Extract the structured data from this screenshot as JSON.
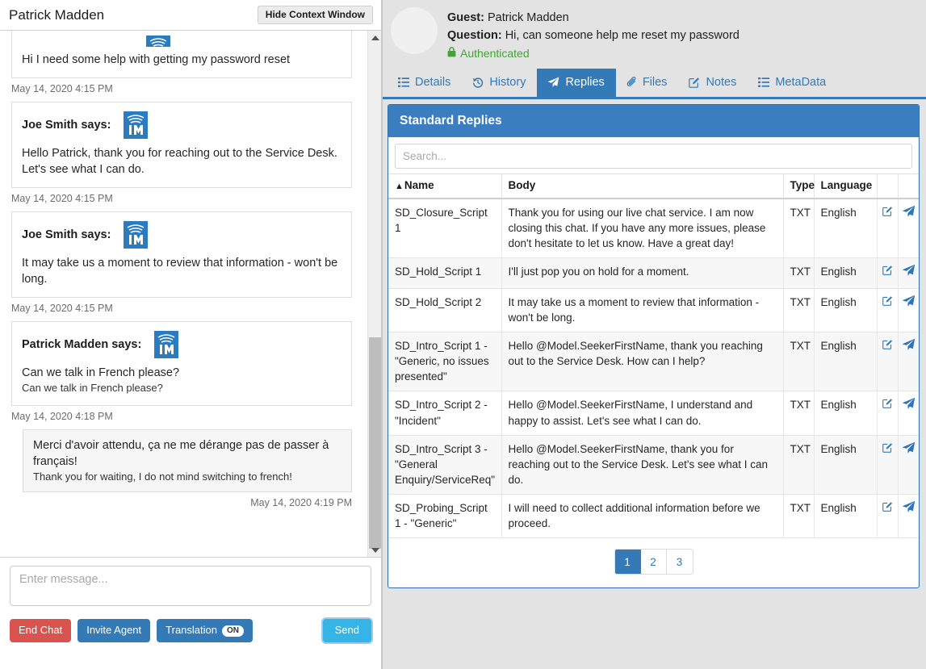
{
  "chat": {
    "title": "Patrick Madden",
    "hide_context_label": "Hide Context Window",
    "messages": [
      {
        "id": "m1",
        "clipped": true,
        "says": "",
        "text": "Hi I need some help with getting my password reset",
        "sub": "",
        "stamp": "May 14, 2020 4:15 PM",
        "align": "left"
      },
      {
        "id": "m2",
        "clipped": false,
        "says": "Joe Smith says:",
        "text": "Hello Patrick, thank you for reaching out to the Service Desk. Let's see what I can do.",
        "sub": "",
        "stamp": "May 14, 2020 4:15 PM",
        "align": "left"
      },
      {
        "id": "m3",
        "clipped": false,
        "says": "Joe Smith says:",
        "text": "It may take us a moment to review that information - won't be long.",
        "sub": "",
        "stamp": "May 14, 2020 4:15 PM",
        "align": "left"
      },
      {
        "id": "m4",
        "clipped": false,
        "says": "Patrick Madden says:",
        "text": "Can we talk in French please?",
        "sub": "Can we talk in French please?",
        "stamp": "May 14, 2020 4:18 PM",
        "align": "left"
      },
      {
        "id": "m5",
        "clipped": false,
        "says": "",
        "text": "Merci d'avoir attendu, ça ne me dérange pas de passer à français!",
        "sub": "Thank you for waiting, I do not mind switching to french!",
        "stamp": "May 14, 2020 4:19 PM",
        "align": "right"
      }
    ],
    "composer": {
      "placeholder": "Enter message...",
      "value": ""
    },
    "actions": {
      "end_chat": "End Chat",
      "invite_agent": "Invite Agent",
      "translation": "Translation",
      "translation_state": "ON",
      "send": "Send"
    }
  },
  "context": {
    "guest_label": "Guest:",
    "guest_name": "Patrick Madden",
    "question_label": "Question:",
    "question_text": "Hi, can someone help me reset my password",
    "auth_status": "Authenticated",
    "tabs": [
      {
        "label": "Details",
        "icon": "list-icon",
        "active": false
      },
      {
        "label": "History",
        "icon": "history-icon",
        "active": false
      },
      {
        "label": "Replies",
        "icon": "paper-plane-icon",
        "active": true
      },
      {
        "label": "Files",
        "icon": "paperclip-icon",
        "active": false
      },
      {
        "label": "Notes",
        "icon": "edit-square-icon",
        "active": false
      },
      {
        "label": "MetaData",
        "icon": "list-icon",
        "active": false
      }
    ]
  },
  "replies_panel": {
    "title": "Standard Replies",
    "search_placeholder": "Search...",
    "search_value": "",
    "columns": {
      "name": "Name",
      "name_sort": "▲",
      "body": "Body",
      "type": "Type",
      "language": "Language"
    },
    "rows": [
      {
        "name": "SD_Closure_Script 1",
        "body": "Thank you for using our live chat service. I am now closing this chat. If you have any more issues, please don't hesitate to let us know. Have a great day!",
        "type": "TXT",
        "language": "English"
      },
      {
        "name": "SD_Hold_Script 1",
        "body": "I'll just pop you on hold for a moment.",
        "type": "TXT",
        "language": "English"
      },
      {
        "name": "SD_Hold_Script 2",
        "body": "It may take us a moment to review that information - won't be long.",
        "type": "TXT",
        "language": "English"
      },
      {
        "name": "SD_Intro_Script 1 - \"Generic, no issues presented\"",
        "body": "Hello @Model.SeekerFirstName, thank you reaching out to the Service Desk. How can I help?",
        "type": "TXT",
        "language": "English"
      },
      {
        "name": "SD_Intro_Script 2 - \"Incident\"",
        "body": "Hello @Model.SeekerFirstName, I understand and happy to assist. Let's see what I can do.",
        "type": "TXT",
        "language": "English"
      },
      {
        "name": "SD_Intro_Script 3 - \"General Enquiry/ServiceReq\"",
        "body": "Hello @Model.SeekerFirstName, thank you for reaching out to the Service Desk. Let's see what I can do.",
        "type": "TXT",
        "language": "English"
      },
      {
        "name": "SD_Probing_Script 1 - \"Generic\"",
        "body": "I will need to collect additional information before we proceed.",
        "type": "TXT",
        "language": "English"
      }
    ],
    "pagination": {
      "pages": [
        "1",
        "2",
        "3"
      ],
      "current": "1"
    }
  },
  "colors": {
    "accent_blue": "#337ab7",
    "panel_header_blue": "#3b7ebf",
    "danger_red": "#d9534f",
    "send_cyan": "#35b5e5",
    "auth_green": "#3fa535",
    "page_bg": "#e3e3e3"
  }
}
